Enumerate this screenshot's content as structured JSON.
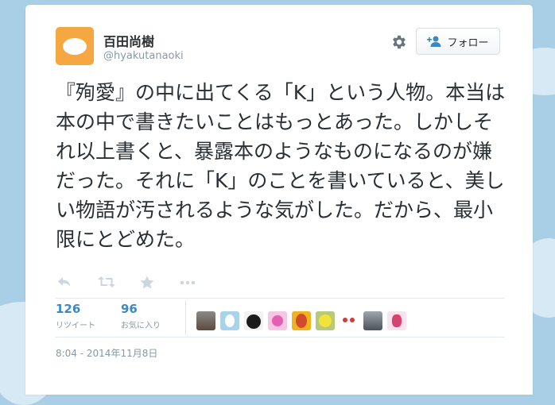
{
  "user": {
    "name": "百田尚樹",
    "handle": "@hyakutanaoki"
  },
  "follow_button": {
    "label": "フォロー"
  },
  "tweet": {
    "text": "『殉愛』の中に出てくる「K」という人物。本当は本の中で書きたいことはもっとあった。しかしそれ以上書くと、暴露本のようなものになるのが嫌だった。それに「K」のことを書いていると、美しい物語が汚されるような気がした。だから、最小限にとどめた。"
  },
  "actions": [
    "reply-icon",
    "retweet-icon",
    "favorite-icon",
    "more-icon"
  ],
  "stats": {
    "retweets": {
      "count": "126",
      "label": "リツイート"
    },
    "favorites": {
      "count": "96",
      "label": "お気に入り"
    }
  },
  "favoriter_avatars": [
    "photo",
    "egg",
    "black-dog",
    "pink-flower",
    "yellow-character",
    "green-yellow-character",
    "white-figure",
    "gray-landscape",
    "pink-character"
  ],
  "timestamp": "8:04 - 2014年11月8日",
  "colors": {
    "background": "#a9cfe6",
    "link": "#3b88c3",
    "text": "#292f33",
    "muted": "#8899a6",
    "avatar": "#f5a742"
  }
}
